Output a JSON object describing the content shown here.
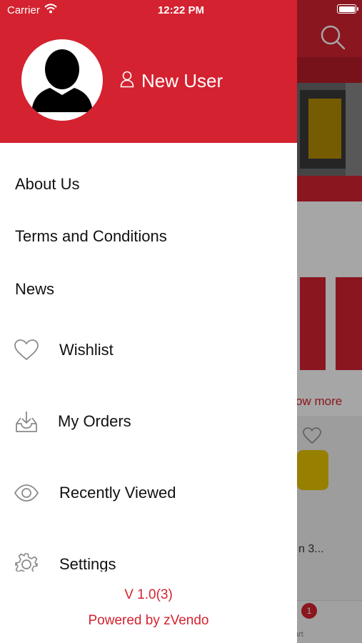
{
  "status_bar": {
    "carrier": "Carrier",
    "time": "12:22 PM"
  },
  "drawer": {
    "user_name": "New User",
    "menu": {
      "about": "About Us",
      "terms": "Terms and Conditions",
      "news": "News",
      "wishlist": "Wishlist",
      "orders": "My Orders",
      "recent": "Recently Viewed",
      "settings": "Settings"
    },
    "version": "V 1.0(3)",
    "powered_by": "Powered by zVendo"
  },
  "background": {
    "show_more": "ow more",
    "product_partial": "n 3...",
    "tab_cart_label": "art",
    "cart_badge": "1"
  },
  "colors": {
    "brand_red": "#d42230",
    "text": "#111111"
  },
  "icons": [
    "wifi-icon",
    "user-outline-icon",
    "avatar-silhouette-icon",
    "heart-icon",
    "inbox-download-icon",
    "eye-icon",
    "gear-icon",
    "search-icon",
    "cart-icon"
  ]
}
